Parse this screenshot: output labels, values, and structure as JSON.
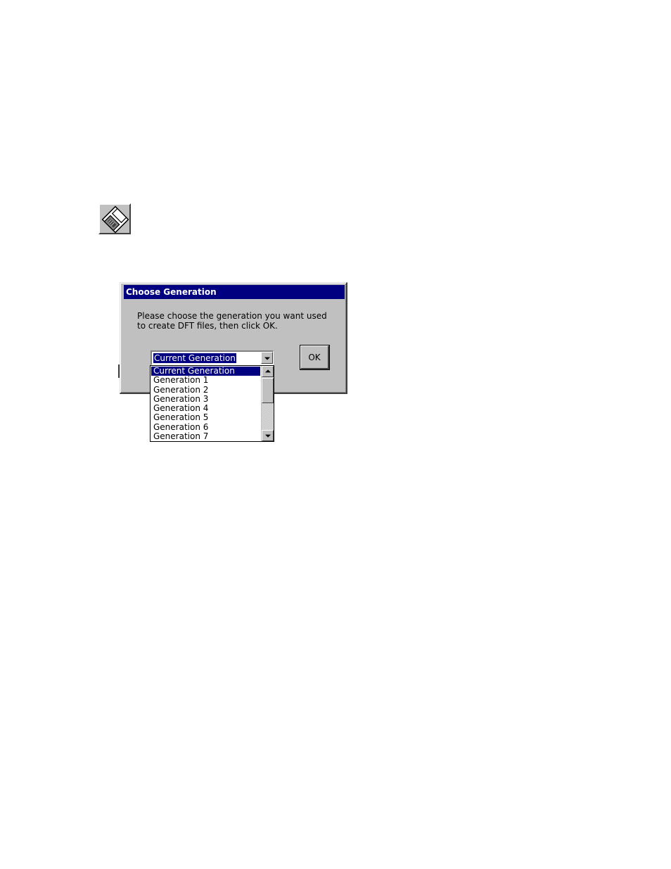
{
  "toolbar": {
    "save_button_icon": "floppy-disk-icon"
  },
  "dialog": {
    "title": "Choose Generation",
    "prompt_line1": "Please choose the generation you want used",
    "prompt_line2": "to create DFT files, then click OK.",
    "ok_label": "OK",
    "combo": {
      "selected_value": "Current Generation",
      "options": [
        "Current Generation",
        "Generation 1",
        "Generation 2",
        "Generation 3",
        "Generation 4",
        "Generation 5",
        "Generation 6",
        "Generation 7"
      ]
    }
  },
  "colors": {
    "title_bar": "#000080",
    "face": "#c0c0c0",
    "highlight": "#000080"
  }
}
